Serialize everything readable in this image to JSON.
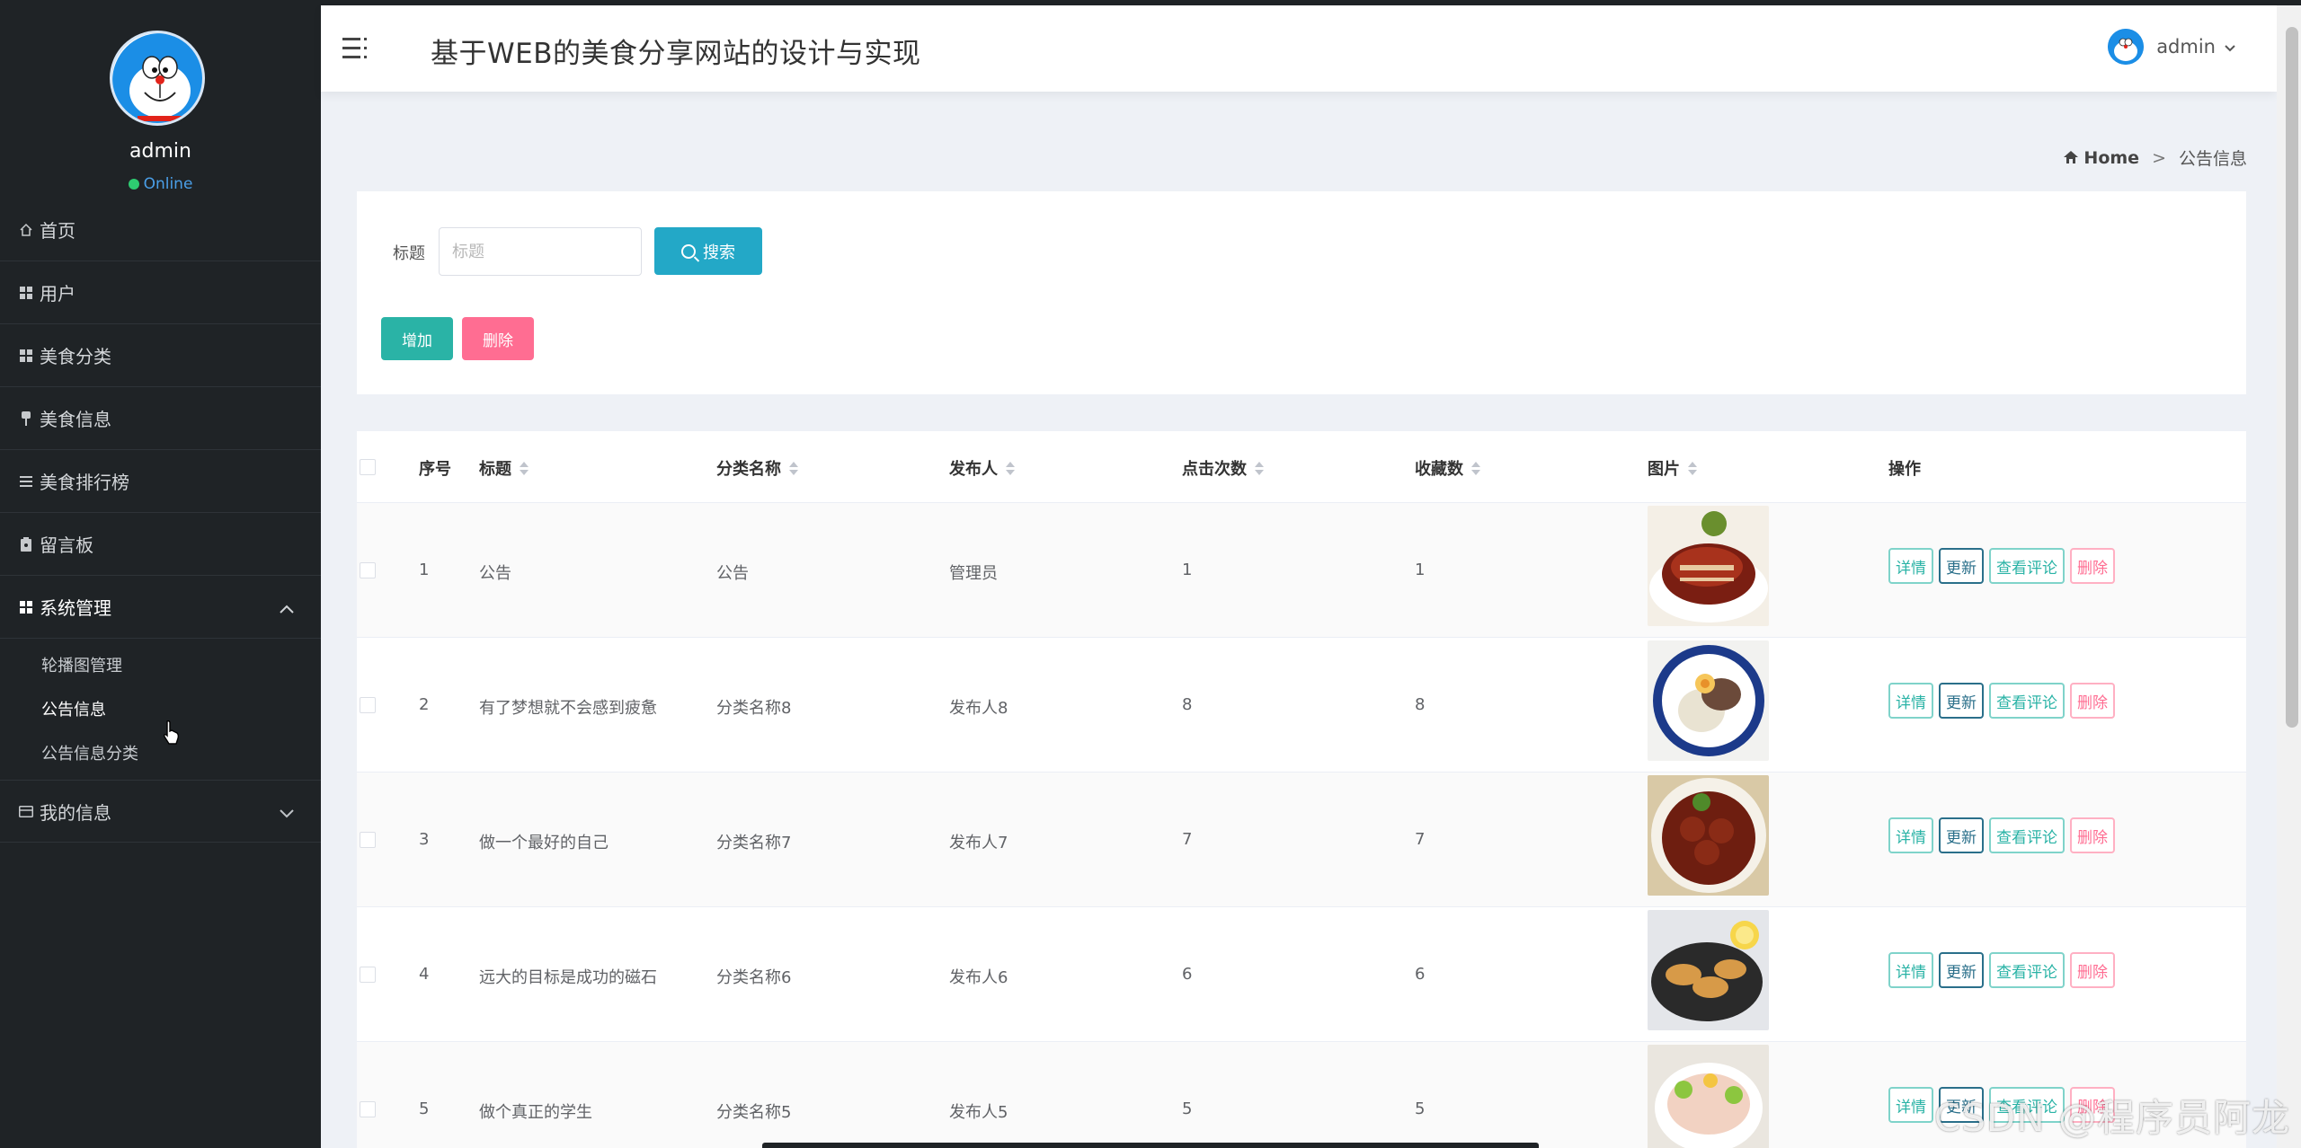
{
  "app": {
    "title": "基于WEB的美食分享网站的设计与实现"
  },
  "sidebar": {
    "username": "admin",
    "status": "Online",
    "items": [
      {
        "label": "首页",
        "icon": "home-icon"
      },
      {
        "label": "用户",
        "icon": "grid-icon"
      },
      {
        "label": "美食分类",
        "icon": "grid-icon"
      },
      {
        "label": "美食信息",
        "icon": "pin-icon"
      },
      {
        "label": "美食排行榜",
        "icon": "list-icon"
      },
      {
        "label": "留言板",
        "icon": "clipboard-icon"
      },
      {
        "label": "系统管理",
        "icon": "grid-icon",
        "expanded": true,
        "children": [
          {
            "label": "轮播图管理"
          },
          {
            "label": "公告信息",
            "current": true
          },
          {
            "label": "公告信息分类"
          }
        ]
      },
      {
        "label": "我的信息",
        "icon": "card-icon",
        "expanded": false
      }
    ]
  },
  "header": {
    "user": "admin"
  },
  "breadcrumb": {
    "home": "Home",
    "separator": ">",
    "current": "公告信息"
  },
  "search": {
    "label": "标题",
    "placeholder": "标题",
    "value": "",
    "button": "搜索"
  },
  "actions": {
    "add": "增加",
    "delete": "删除"
  },
  "table": {
    "columns": [
      "序号",
      "标题",
      "分类名称",
      "发布人",
      "点击次数",
      "收藏数",
      "图片",
      "操作"
    ],
    "op_labels": {
      "detail": "详情",
      "update": "更新",
      "comments": "查看评论",
      "delete": "删除"
    },
    "rows": [
      {
        "index": "1",
        "title": "公告",
        "category": "公告",
        "publisher": "管理员",
        "clicks": "1",
        "favorites": "1"
      },
      {
        "index": "2",
        "title": "有了梦想就不会感到疲惫",
        "category": "分类名称8",
        "publisher": "发布人8",
        "clicks": "8",
        "favorites": "8"
      },
      {
        "index": "3",
        "title": "做一个最好的自己",
        "category": "分类名称7",
        "publisher": "发布人7",
        "clicks": "7",
        "favorites": "7"
      },
      {
        "index": "4",
        "title": "远大的目标是成功的磁石",
        "category": "分类名称6",
        "publisher": "发布人6",
        "clicks": "6",
        "favorites": "6"
      },
      {
        "index": "5",
        "title": "做个真正的学生",
        "category": "分类名称5",
        "publisher": "发布人5",
        "clicks": "5",
        "favorites": "5"
      }
    ]
  },
  "watermark": "CSDN @程序员阿龙",
  "colors": {
    "sidebar_bg": "#1f2326",
    "search_btn": "#23a8c7",
    "add_btn": "#2ab3a6",
    "delete_btn": "#ff6d92",
    "page_bg": "#eef1f6"
  }
}
